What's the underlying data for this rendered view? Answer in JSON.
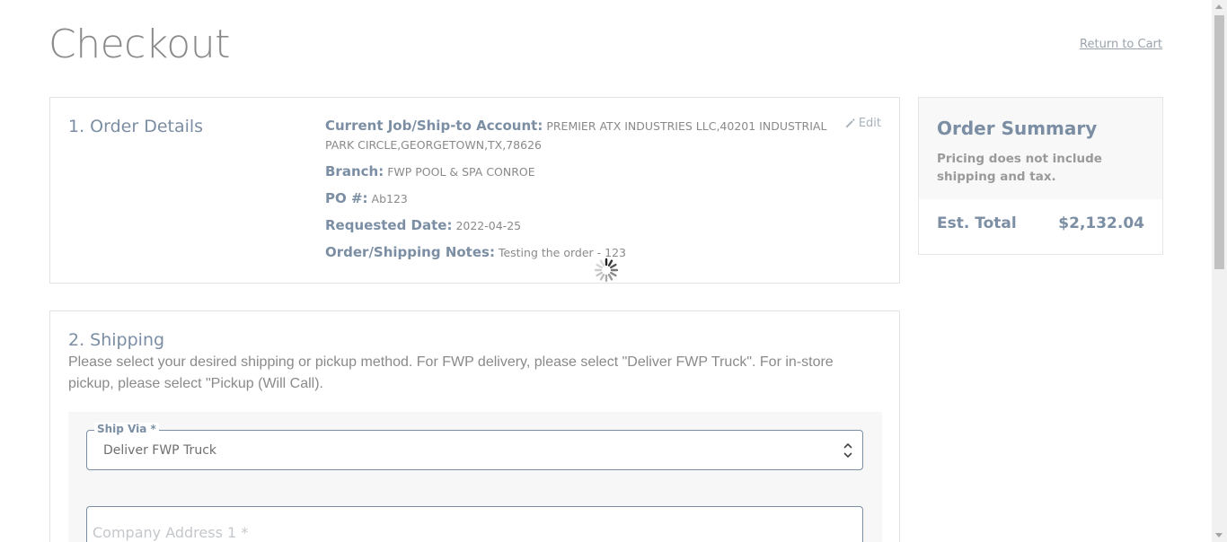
{
  "page": {
    "title": "Checkout",
    "return_link": "Return to Cart"
  },
  "order_details": {
    "title": "1. Order Details",
    "edit_label": "Edit",
    "rows": [
      {
        "label": "Current Job/Ship-to Account:",
        "value": "PREMIER ATX INDUSTRIES LLC,40201 INDUSTRIAL PARK CIRCLE,GEORGETOWN,TX,78626"
      },
      {
        "label": "Branch:",
        "value": "FWP POOL & SPA CONROE"
      },
      {
        "label": "PO #:",
        "value": "Ab123"
      },
      {
        "label": "Requested Date:",
        "value": "2022-04-25"
      },
      {
        "label": "Order/Shipping Notes:",
        "value": "Testing the order - 123"
      }
    ]
  },
  "shipping": {
    "title": "2. Shipping",
    "description": "Please select your desired shipping or pickup method. For FWP delivery, please select \"Deliver FWP Truck\". For in-store pickup, please select \"Pickup (Will Call).",
    "ship_via": {
      "label": "Ship Via *",
      "value": "Deliver FWP Truck"
    },
    "company_address_1": {
      "placeholder": "Company Address 1 *",
      "value": ""
    }
  },
  "summary": {
    "title": "Order Summary",
    "note": "Pricing does not include shipping and tax.",
    "est_total_label": "Est. Total",
    "est_total_value": "$2,132.04"
  },
  "icons": {
    "edit": "pencil-icon",
    "loading": "spinner-icon",
    "select_caret": "chevron-updown-icon"
  },
  "colors": {
    "accent": "#7b8ea3",
    "muted_text": "#8a8a8a",
    "border": "#e3e3e3"
  }
}
